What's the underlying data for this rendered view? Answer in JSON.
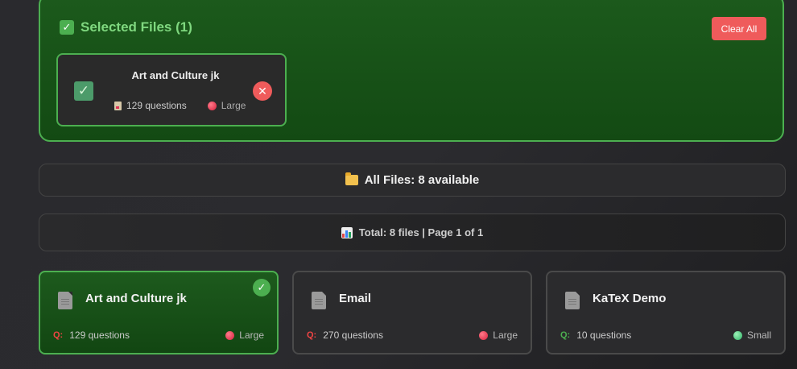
{
  "selected": {
    "title": "Selected Files (1)",
    "clear_label": "Clear All",
    "items": [
      {
        "name": "Art and Culture jk",
        "questions": "129 questions",
        "size": "Large",
        "size_color": "#d6203c"
      }
    ]
  },
  "all_files": {
    "label": "All Files: 8 available"
  },
  "pagination": {
    "label": "Total: 8 files | Page 1 of 1"
  },
  "files": [
    {
      "name": "Art and Culture jk",
      "q_prefix": "Q:",
      "questions": "129 questions",
      "size": "Large",
      "selected": true
    },
    {
      "name": "Email",
      "q_prefix": "Q:",
      "questions": "270 questions",
      "size": "Large",
      "selected": false
    },
    {
      "name": "KaTeX Demo",
      "q_prefix": "Q:",
      "questions": "10 questions",
      "size": "Small",
      "selected": false
    }
  ],
  "colors": {
    "accent": "#4caf50",
    "danger": "#ef5b5b",
    "selected_bg": "#1a521a"
  }
}
